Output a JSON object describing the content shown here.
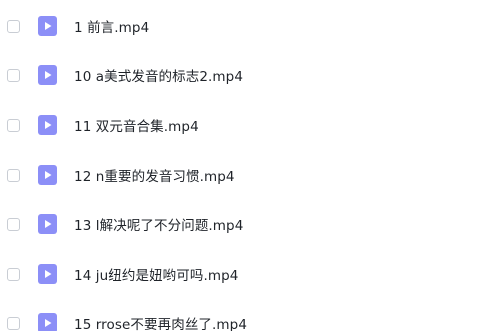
{
  "file_list": {
    "icon_color": "#8c8ff7",
    "icon": "video-file-icon",
    "items": [
      {
        "name": "1 前言.mp4",
        "checked": false
      },
      {
        "name": "10 a美式发音的标志2.mp4",
        "checked": false
      },
      {
        "name": "11 双元音合集.mp4",
        "checked": false
      },
      {
        "name": "12 n重要的发音习惯.mp4",
        "checked": false
      },
      {
        "name": "13 l解决呢了不分问题.mp4",
        "checked": false
      },
      {
        "name": "14 ju纽约是妞哟可吗.mp4",
        "checked": false
      },
      {
        "name": "15 rrose不要再肉丝了.mp4",
        "checked": false
      }
    ]
  }
}
